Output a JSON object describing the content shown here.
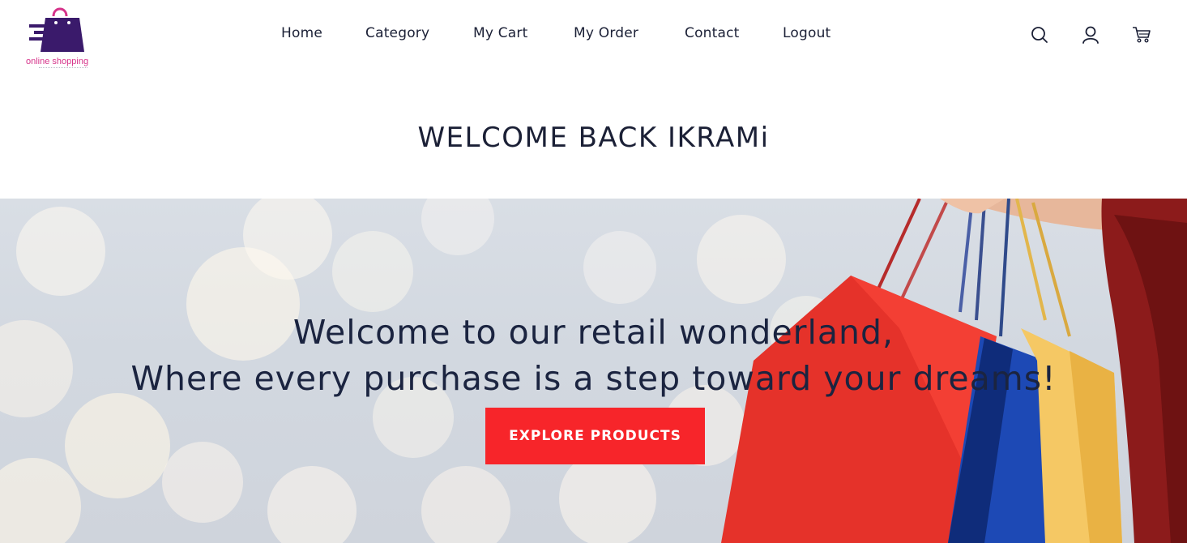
{
  "brand": {
    "name": "online shopping",
    "colors": {
      "bag": "#3a1a6b",
      "text": "#d6338a"
    }
  },
  "nav": {
    "items": [
      {
        "label": "Home"
      },
      {
        "label": "Category"
      },
      {
        "label": "My Cart"
      },
      {
        "label": "My Order"
      },
      {
        "label": "Contact"
      },
      {
        "label": "Logout"
      }
    ]
  },
  "header_icons": {
    "search": "search-icon",
    "account": "user-icon",
    "cart": "cart-icon"
  },
  "welcome": {
    "title": "WELCOME BACK IKRAMi"
  },
  "hero": {
    "line1": "Welcome to our retail wonderland,",
    "line2": "Where every purchase is a step toward your dreams!",
    "cta_label": "EXPLORE PRODUCTS",
    "cta_color": "#f7252a"
  }
}
